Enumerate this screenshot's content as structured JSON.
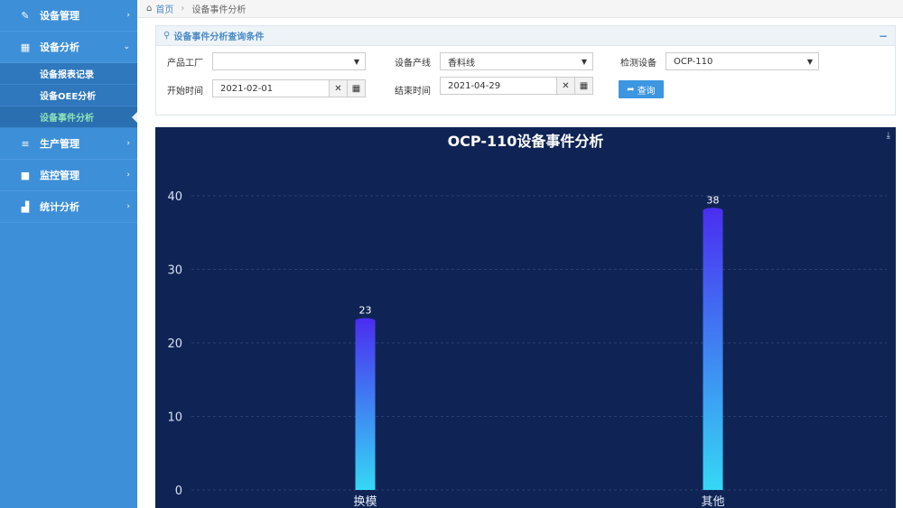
{
  "sidebar": {
    "items": [
      {
        "icon": "wrench-icon",
        "label": "设备管理",
        "caret": "›"
      },
      {
        "icon": "grid-icon",
        "label": "设备分析",
        "caret": "⌄"
      },
      {
        "icon": "list-icon",
        "label": "生产管理",
        "caret": "›"
      },
      {
        "icon": "video-icon",
        "label": "监控管理",
        "caret": "›"
      },
      {
        "icon": "bar-chart-icon",
        "label": "统计分析",
        "caret": "›"
      }
    ],
    "submenu": [
      "设备报表记录",
      "设备OEE分析",
      "设备事件分析"
    ]
  },
  "breadcrumb": {
    "home": "首页",
    "current": "设备事件分析"
  },
  "query": {
    "title": "设备事件分析查询条件",
    "factory_label": "产品工厂",
    "factory_value": "",
    "line_label": "设备产线",
    "line_value": "香料线",
    "device_label": "检测设备",
    "device_value": "OCP-110",
    "start_label": "开始时间",
    "start_value": "2021-02-01",
    "end_label": "结束时间",
    "end_value": "2021-04-29",
    "button_label": "查询"
  },
  "chart_data": {
    "type": "bar",
    "title": "OCP-110设备事件分析",
    "categories": [
      "换模",
      "其他"
    ],
    "values": [
      23,
      38
    ],
    "ylim": [
      0,
      40
    ],
    "yticks": [
      0,
      10,
      20,
      30,
      40
    ],
    "grid": true,
    "colors": {
      "bar_top": "#4a2ff0",
      "bar_bottom": "#35d8f5",
      "background": "#0f2455"
    }
  }
}
